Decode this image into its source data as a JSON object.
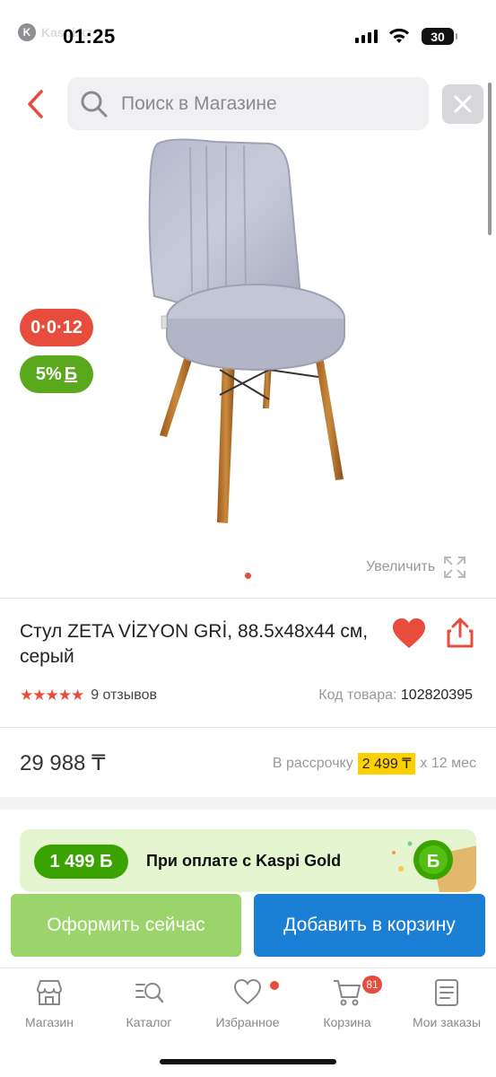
{
  "status_bar": {
    "carrier": "Kaspi.kz",
    "time": "01:25",
    "battery": "30"
  },
  "search": {
    "placeholder": "Поиск в Магазине"
  },
  "product": {
    "badge_installment": "0·0·12",
    "badge_bonus_percent": "5%",
    "badge_bonus_symbol": "Б",
    "zoom_label": "Увеличить",
    "title": "Стул ZETA VİZYON GRİ, 88.5x48x44 см, серый",
    "stars": "★★★★★",
    "reviews": "9 отзывов",
    "code_label": "Код товара:",
    "code_value": "102820395",
    "price": "29 988 ₸",
    "installment_label": "В рассрочку",
    "installment_amount": "2 499 ₸",
    "installment_term": "x 12 мес"
  },
  "promo": {
    "amount": "1 499 Б",
    "text": "При оплате с Kaspi Gold"
  },
  "actions": {
    "buy_now": "Оформить сейчас",
    "add_to_cart": "Добавить в корзину"
  },
  "tabs": [
    {
      "label": "Магазин",
      "icon": "store-icon"
    },
    {
      "label": "Каталог",
      "icon": "catalog-search-icon"
    },
    {
      "label": "Избранное",
      "icon": "heart-icon",
      "dot": true
    },
    {
      "label": "Корзина",
      "icon": "cart-icon",
      "badge": "81"
    },
    {
      "label": "Мои заказы",
      "icon": "orders-icon"
    }
  ],
  "colors": {
    "accent_red": "#e74c3c",
    "kaspi_green": "#5aa81c",
    "button_green": "#9ad46a",
    "button_blue": "#1b7fd6",
    "highlight_yellow": "#ffd000"
  }
}
